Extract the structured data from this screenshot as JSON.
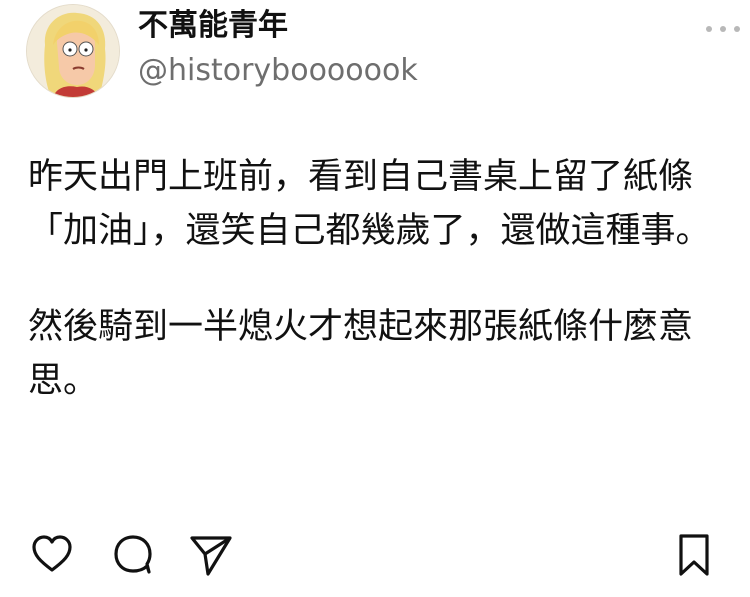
{
  "post": {
    "author": {
      "display_name": "不萬能青年",
      "handle": "@historybooooook",
      "avatar": "cartoon-woman-avatar"
    },
    "paragraphs": [
      "昨天出門上班前，看到自己書桌上留了紙條「加油」，還笑自己都幾歲了，還做這種事。",
      "然後騎到一半熄火才想起來那張紙條什麼意思。"
    ]
  },
  "actions": {
    "icons": [
      "heart-icon",
      "comment-icon",
      "send-icon",
      "bookmark-icon"
    ]
  },
  "colors": {
    "text": "#111111",
    "handle": "#6e6e6e",
    "more_dots": "#b8b8b8",
    "background": "#ffffff"
  }
}
